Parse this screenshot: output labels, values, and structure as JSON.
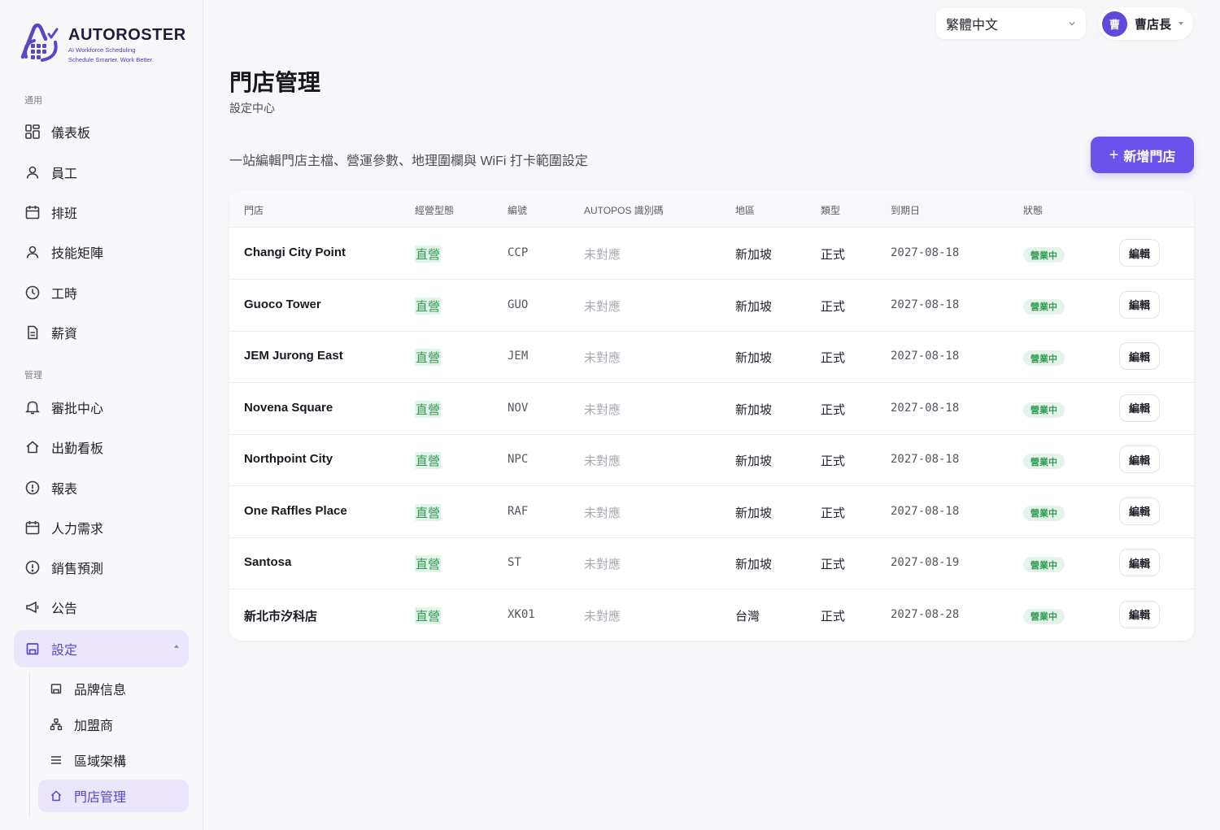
{
  "brand": {
    "name": "AUTOROSTER",
    "tagline1": "AI Workforce Scheduling",
    "tagline2": "Schedule Smarter. Work Better."
  },
  "sidebar": {
    "section_general": "通用",
    "section_manage": "管理",
    "general_items": [
      {
        "label": "儀表板",
        "icon": "dashboard-icon"
      },
      {
        "label": "員工",
        "icon": "user-icon"
      },
      {
        "label": "排班",
        "icon": "calendar-icon"
      },
      {
        "label": "技能矩陣",
        "icon": "user-icon"
      },
      {
        "label": "工時",
        "icon": "clock-icon"
      },
      {
        "label": "薪資",
        "icon": "document-icon"
      }
    ],
    "manage_items": [
      {
        "label": "審批中心",
        "icon": "bell-icon"
      },
      {
        "label": "出勤看板",
        "icon": "home-icon"
      },
      {
        "label": "報表",
        "icon": "alert-circle-icon"
      },
      {
        "label": "人力需求",
        "icon": "calendar-icon"
      },
      {
        "label": "銷售預測",
        "icon": "alert-circle-icon"
      },
      {
        "label": "公告",
        "icon": "megaphone-icon"
      }
    ],
    "settings": {
      "label": "設定",
      "icon": "store-icon",
      "expanded": true
    },
    "settings_children": [
      {
        "label": "品牌信息",
        "icon": "store-icon"
      },
      {
        "label": "加盟商",
        "icon": "hierarchy-icon"
      },
      {
        "label": "區域架構",
        "icon": "list-icon"
      },
      {
        "label": "門店管理",
        "icon": "home-icon",
        "active": true
      }
    ]
  },
  "topbar": {
    "language": "繁體中文",
    "user": {
      "avatar_text": "曹",
      "name": "曹店長"
    }
  },
  "header": {
    "title": "門店管理",
    "subtitle": "設定中心",
    "description": "一站編輯門店主檔、營運參數、地理圍欄與 WiFi 打卡範圍設定",
    "add_button": "新增門店"
  },
  "table": {
    "columns": [
      "門店",
      "經營型態",
      "編號",
      "AUTOPOS 識別碼",
      "地區",
      "類型",
      "到期日",
      "狀態"
    ],
    "edit_label": "編輯",
    "rows": [
      {
        "name": "Changi City Point",
        "type": "直營",
        "code": "CCP",
        "pos": "未對應",
        "region": "新加坡",
        "kind": "正式",
        "date": "2027-08-18",
        "status": "營業中"
      },
      {
        "name": "Guoco Tower",
        "type": "直營",
        "code": "GUO",
        "pos": "未對應",
        "region": "新加坡",
        "kind": "正式",
        "date": "2027-08-18",
        "status": "營業中"
      },
      {
        "name": "JEM Jurong East",
        "type": "直營",
        "code": "JEM",
        "pos": "未對應",
        "region": "新加坡",
        "kind": "正式",
        "date": "2027-08-18",
        "status": "營業中"
      },
      {
        "name": "Novena Square",
        "type": "直營",
        "code": "NOV",
        "pos": "未對應",
        "region": "新加坡",
        "kind": "正式",
        "date": "2027-08-18",
        "status": "營業中"
      },
      {
        "name": "Northpoint City",
        "type": "直營",
        "code": "NPC",
        "pos": "未對應",
        "region": "新加坡",
        "kind": "正式",
        "date": "2027-08-18",
        "status": "營業中"
      },
      {
        "name": "One Raffles Place",
        "type": "直營",
        "code": "RAF",
        "pos": "未對應",
        "region": "新加坡",
        "kind": "正式",
        "date": "2027-08-18",
        "status": "營業中"
      },
      {
        "name": "Santosa",
        "type": "直營",
        "code": "ST",
        "pos": "未對應",
        "region": "新加坡",
        "kind": "正式",
        "date": "2027-08-19",
        "status": "營業中"
      },
      {
        "name": "新北市汐科店",
        "type": "直營",
        "code": "XK01",
        "pos": "未對應",
        "region": "台灣",
        "kind": "正式",
        "date": "2027-08-28",
        "status": "營業中"
      }
    ]
  },
  "colors": {
    "accent": "#6a52ea",
    "active_bg": "#ebe6fb",
    "success": "#2e9a52",
    "success_bg": "#e5f4ea"
  }
}
